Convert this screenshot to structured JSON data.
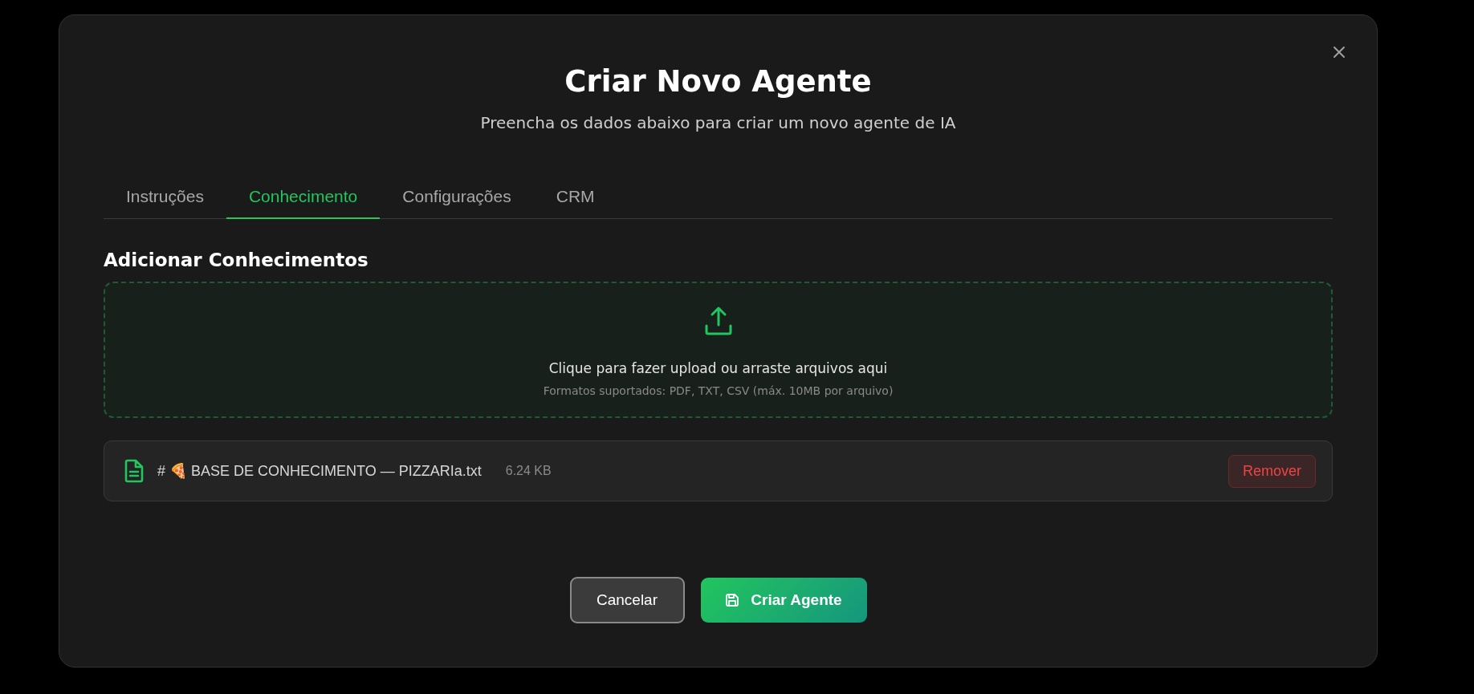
{
  "dialog": {
    "title": "Criar Novo Agente",
    "subtitle": "Preencha os dados abaixo para criar um novo agente de IA"
  },
  "tabs": [
    {
      "label": "Instruções",
      "selected": false
    },
    {
      "label": "Conhecimento",
      "selected": true
    },
    {
      "label": "Configurações",
      "selected": false
    },
    {
      "label": "CRM",
      "selected": false
    }
  ],
  "section_title": "Adicionar Conhecimentos",
  "upload": {
    "prompt": "Clique para fazer upload ou arraste arquivos aqui",
    "hint": "Formatos suportados: PDF, TXT, CSV (máx. 10MB por arquivo)"
  },
  "files": [
    {
      "name": "# 🍕 BASE DE CONHECIMENTO — PIZZARIa.txt",
      "size": "6.24 KB",
      "action": "Remover"
    }
  ],
  "buttons": {
    "cancel": "Cancelar",
    "submit": "Criar Agente"
  }
}
